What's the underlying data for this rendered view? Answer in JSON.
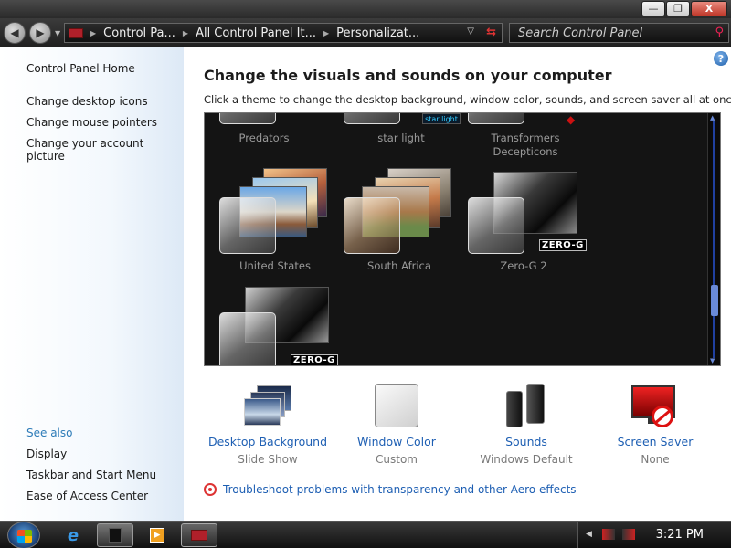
{
  "window": {
    "minimize": "—",
    "maximize": "❐",
    "close": "X"
  },
  "address": {
    "crumbs": [
      "Control Pa...",
      "All Control Panel It...",
      "Personalizat..."
    ],
    "search_placeholder": "Search Control Panel"
  },
  "leftnav": {
    "links": [
      "Control Panel Home",
      "Change desktop icons",
      "Change mouse pointers",
      "Change your account picture"
    ],
    "see_also": "See also",
    "see_also_links": [
      "Display",
      "Taskbar and Start Menu",
      "Ease of Access Center"
    ]
  },
  "main": {
    "heading": "Change the visuals and sounds on your computer",
    "subtext": "Click a theme to change the desktop background, window color, sounds, and screen saver all at once."
  },
  "themes": {
    "row1": [
      "Predators",
      "star light",
      "Transformers\nDecepticons"
    ],
    "row2": [
      "United States",
      "South Africa",
      "Zero-G 2"
    ],
    "zerog_badge": "ZERO-G",
    "starlight_badge": "star light"
  },
  "options": [
    {
      "label": "Desktop Background",
      "sub": "Slide Show",
      "icon": "desktop-background-icon"
    },
    {
      "label": "Window Color",
      "sub": "Custom",
      "icon": "window-color-icon"
    },
    {
      "label": "Sounds",
      "sub": "Windows Default",
      "icon": "sounds-icon"
    },
    {
      "label": "Screen Saver",
      "sub": "None",
      "icon": "screen-saver-icon"
    }
  ],
  "troubleshoot": "Troubleshoot problems with transparency and other Aero effects",
  "taskbar": {
    "clock": "3:21 PM"
  }
}
